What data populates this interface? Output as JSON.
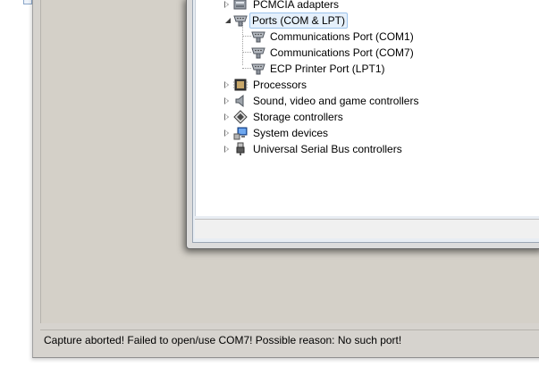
{
  "device_tree": {
    "items": [
      {
        "label": "PCMCIA adapters",
        "icon": "pcmcia-icon",
        "expander": "collapsed"
      },
      {
        "label": "Ports (COM & LPT)",
        "icon": "port-icon",
        "expander": "expanded",
        "selected": true
      },
      {
        "label": "Communications Port (COM1)",
        "icon": "port-icon",
        "child": true
      },
      {
        "label": "Communications Port (COM7)",
        "icon": "port-icon",
        "child": true
      },
      {
        "label": "ECP Printer Port (LPT1)",
        "icon": "port-icon",
        "child": true
      },
      {
        "label": "Processors",
        "icon": "processor-icon",
        "expander": "collapsed"
      },
      {
        "label": "Sound, video and game controllers",
        "icon": "speaker-icon",
        "expander": "collapsed"
      },
      {
        "label": "Storage controllers",
        "icon": "storage-icon",
        "expander": "collapsed"
      },
      {
        "label": "System devices",
        "icon": "system-devices-icon",
        "expander": "collapsed"
      },
      {
        "label": "Universal Serial Bus controllers",
        "icon": "usb-icon",
        "expander": "collapsed"
      }
    ]
  },
  "status_bar": {
    "message": "Capture aborted! Failed to open/use COM7! Possible reason: No such port!"
  },
  "colors": {
    "app_background": "#d6d3ce",
    "tree_background": "#ffffff",
    "selection_fill": "#e5f0fb",
    "selection_border": "#9cc3eb"
  }
}
